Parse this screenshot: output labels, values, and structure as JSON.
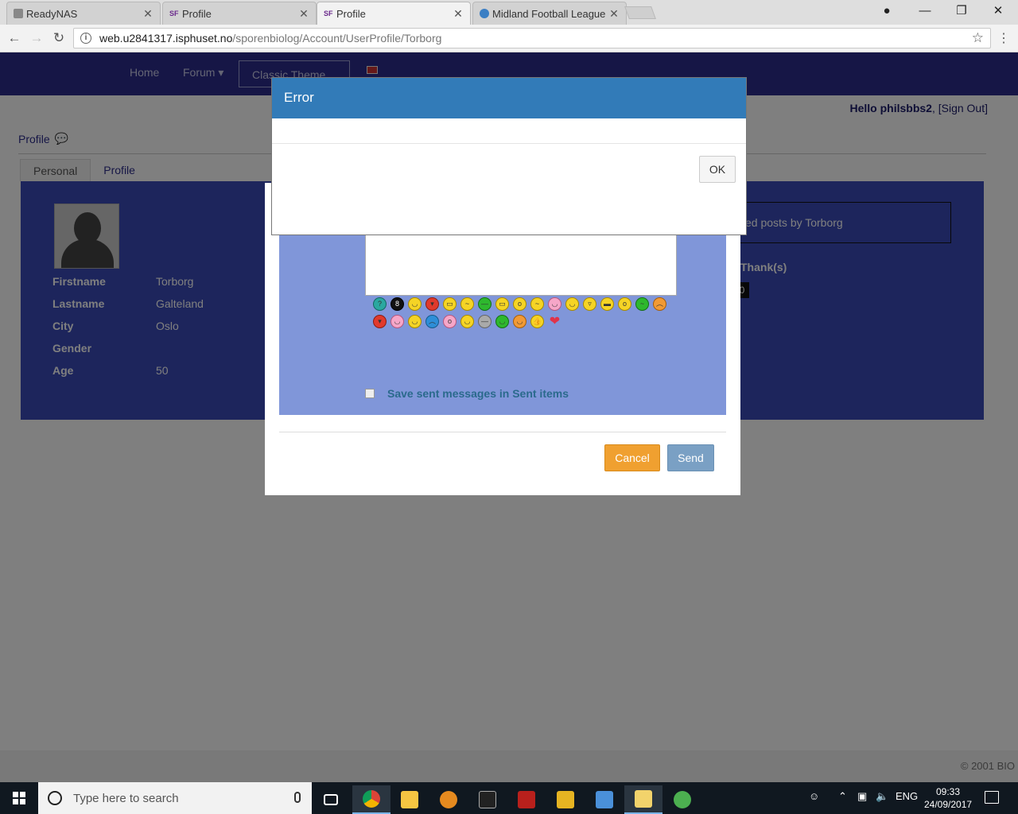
{
  "browser": {
    "tabs": [
      {
        "label": "ReadyNAS",
        "favicon": "readynas-favicon"
      },
      {
        "label": "Profile",
        "favicon": "sf-favicon"
      },
      {
        "label": "Profile",
        "favicon": "sf-favicon",
        "active": true
      },
      {
        "label": "Midland Football League",
        "favicon": "globe-favicon"
      }
    ],
    "url_host": "web.u2841317.isphuset.no",
    "url_path": "/sporenbiolog/Account/UserProfile/Torborg"
  },
  "site": {
    "nav": {
      "home": "Home",
      "forum": "Forum",
      "theme": "Classic Theme"
    },
    "hello_prefix": "Hello",
    "username": "philsbbs2",
    "sign_out": "[Sign Out]",
    "profile_heading": "Profile",
    "tabs": [
      "Personal",
      "Profile"
    ],
    "fields": [
      {
        "label": "Firstname",
        "value": "Torborg"
      },
      {
        "label": "Lastname",
        "value": "Galteland"
      },
      {
        "label": "City",
        "value": "Oslo"
      },
      {
        "label": "Gender",
        "value": ""
      },
      {
        "label": "Age",
        "value": "50"
      }
    ],
    "posts_link": "ed posts by Torborg",
    "thanks_label": "Thank(s)",
    "thanks_count": "0",
    "copyright": "© 2001 BIO"
  },
  "message_dialog": {
    "save_sent_label": "Save sent messages in Sent items",
    "cancel": "Cancel",
    "send": "Send"
  },
  "error_dialog": {
    "title": "Error",
    "ok": "OK"
  },
  "taskbar": {
    "search_placeholder": "Type here to search",
    "language": "ENG",
    "time": "09:33",
    "date": "24/09/2017"
  },
  "colors": {
    "nav_bg": "#2c2c8c",
    "error_header": "#327bb8",
    "cancel_btn": "#f0a030",
    "send_btn": "#7aa0c4"
  }
}
